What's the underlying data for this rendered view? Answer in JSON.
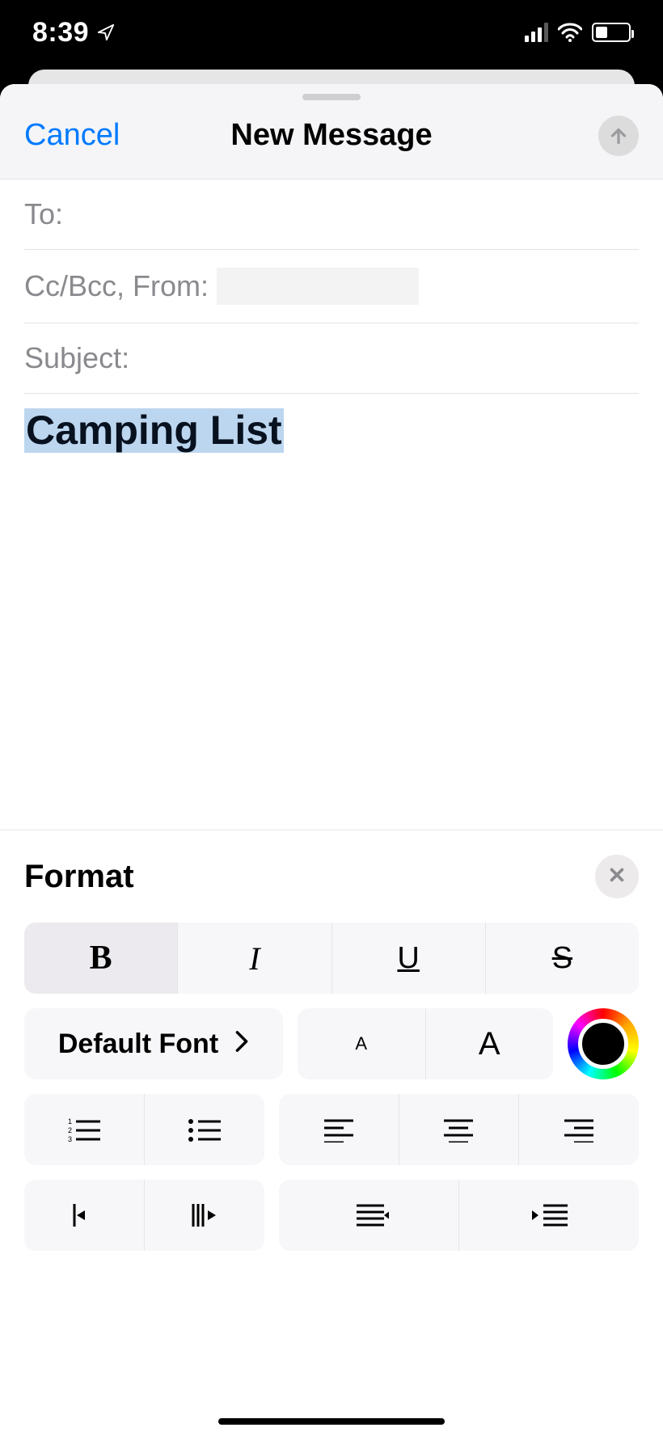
{
  "statusbar": {
    "time": "8:39"
  },
  "compose": {
    "cancel_label": "Cancel",
    "title": "New Message",
    "to_label": "To:",
    "ccbcc_label": "Cc/Bcc, From:",
    "subject_label": "Subject:",
    "body_selected_text": "Camping List"
  },
  "format_panel": {
    "title": "Format",
    "bold_glyph": "B",
    "italic_glyph": "I",
    "underline_glyph": "U",
    "strike_glyph": "S",
    "font_label": "Default Font",
    "size_small_glyph": "A",
    "size_large_glyph": "A",
    "color_value": "#000000"
  }
}
